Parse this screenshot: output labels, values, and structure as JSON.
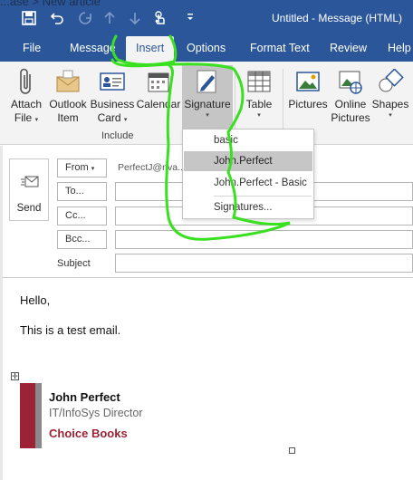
{
  "background_window": {
    "text": "...ase  >  New article"
  },
  "quick_access": {
    "save_icon": "save-icon",
    "undo_icon": "undo-icon",
    "redo_icon": "redo-icon",
    "up_icon": "arrow-up-icon",
    "down_icon": "arrow-down-icon",
    "touch_icon": "touch-mode-icon",
    "customize_icon": "customize-icon"
  },
  "window": {
    "title": "Untitled  -  Message (HTML)"
  },
  "tabs": [
    {
      "label": "File"
    },
    {
      "label": "Message"
    },
    {
      "label": "Insert"
    },
    {
      "label": "Options"
    },
    {
      "label": "Format Text"
    },
    {
      "label": "Review"
    },
    {
      "label": "Help"
    }
  ],
  "ribbon": {
    "attach_file": {
      "line1": "Attach",
      "line2": "File"
    },
    "outlook_item": {
      "line1": "Outlook",
      "line2": "Item"
    },
    "business_card": {
      "line1": "Business",
      "line2": "Card"
    },
    "calendar": {
      "line1": "Calendar"
    },
    "signature": {
      "line1": "Signature"
    },
    "table": {
      "line1": "Table"
    },
    "pictures": {
      "line1": "Pictures"
    },
    "online_pictures": {
      "line1": "Online",
      "line2": "Pictures"
    },
    "shapes": {
      "line1": "Shapes"
    },
    "caret": "▾",
    "group_include": "Include"
  },
  "signature_menu": {
    "items": [
      {
        "label": "basic"
      },
      {
        "label": "John.Perfect"
      },
      {
        "label": "John.Perfect - Basic"
      },
      {
        "label": "Signatures..."
      }
    ],
    "highlighted_index": 1
  },
  "compose": {
    "send_label": "Send",
    "from_label": "From",
    "from_caret": "▾",
    "from_address": "PerfectJ@nva...",
    "to_label": "To...",
    "cc_label": "Cc...",
    "bcc_label": "Bcc...",
    "subject_label": "Subject",
    "to_value": "",
    "cc_value": "",
    "bcc_value": "",
    "subject_value": ""
  },
  "body": {
    "greeting": "Hello,",
    "line1": "This is a test email.",
    "signature": {
      "name": "John Perfect",
      "title": "IT/InfoSys Director",
      "company": "Choice Books"
    }
  },
  "colors": {
    "brand_blue": "#2b579a",
    "signature_red": "#9b2335",
    "annotation_green": "#39e01f"
  }
}
